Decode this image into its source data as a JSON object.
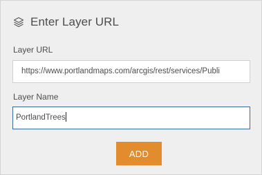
{
  "dialog": {
    "title": "Enter Layer URL",
    "icon": "layers-icon"
  },
  "layer_url": {
    "label": "Layer URL",
    "value": "https://www.portlandmaps.com/arcgis/rest/services/Publi"
  },
  "layer_name": {
    "label": "Layer Name",
    "value": "PortlandTrees"
  },
  "actions": {
    "add_label": "ADD"
  },
  "colors": {
    "accent": "#e38c2e",
    "focus_border": "#3b6a9a",
    "panel_bg": "#efefef",
    "text": "#4c4c4c"
  }
}
